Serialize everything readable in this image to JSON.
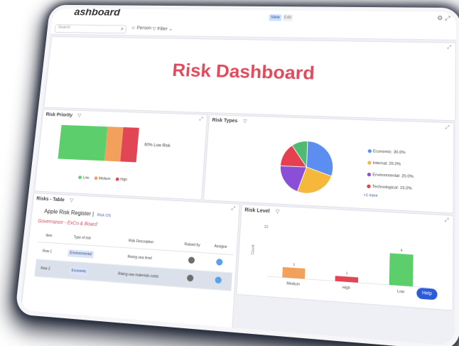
{
  "app": {
    "title": "ashboard",
    "view_toggle": "View",
    "edit_toggle": "Edit"
  },
  "toolbar": {
    "search_placeholder": "Search",
    "person_label": "Person",
    "filter_label": "Filter"
  },
  "dashboard": {
    "title": "Risk Dashboard"
  },
  "priority_panel": {
    "title": "Risk Priority",
    "annotation": "60% Low Risk",
    "legend": [
      "Low",
      "Medium",
      "High"
    ]
  },
  "types_panel": {
    "title": "Risk Types",
    "legend": [
      "Economic: 30.0%",
      "Internal: 25.0%",
      "Environmental: 20.0%",
      "Technological: 15.0%"
    ],
    "more": "+1 more"
  },
  "table_panel": {
    "title": "Risks - Table",
    "register_title": "Apple Risk Register",
    "register_tag": "Risk OS",
    "group_label": "Governance - ExCo & Board",
    "columns": [
      "Item",
      "Type of risk",
      "Risk Description",
      "Raised by",
      "Assigne"
    ],
    "rows": [
      {
        "item": "Row 1",
        "type": "Environmental",
        "desc": "Rising sea level"
      },
      {
        "item": "Row 2",
        "type": "Economic",
        "desc": "Rising raw materials costs"
      }
    ]
  },
  "level_panel": {
    "title": "Risk Level",
    "ylabel": "Count",
    "ytick": "10"
  },
  "help": {
    "label": "Help"
  },
  "colors": {
    "accent": "#e14b5e",
    "low": "#5ccf6c",
    "medium": "#f2a05b",
    "high": "#e04653",
    "economic": "#5b8ef0",
    "internal": "#f5b83b",
    "environmental": "#8a4fd6",
    "technological": "#e5404f",
    "other": "#4fba72"
  },
  "chart_data": [
    {
      "type": "bar",
      "stacked": true,
      "orientation": "horizontal",
      "categories": [
        "Low",
        "Medium",
        "High"
      ],
      "values": [
        60,
        20,
        20
      ],
      "title": "Risk Priority"
    },
    {
      "type": "pie",
      "title": "Risk Types",
      "categories": [
        "Economic",
        "Internal",
        "Environmental",
        "Technological",
        "Other"
      ],
      "values": [
        30,
        25,
        20,
        15,
        10
      ]
    },
    {
      "type": "bar",
      "title": "Risk Level",
      "categories": [
        "Medium",
        "High",
        "Low"
      ],
      "values": [
        2,
        1,
        6
      ],
      "data_labels": [
        "2",
        "1",
        "6"
      ],
      "ylabel": "Count",
      "ylim": [
        0,
        10
      ]
    }
  ]
}
